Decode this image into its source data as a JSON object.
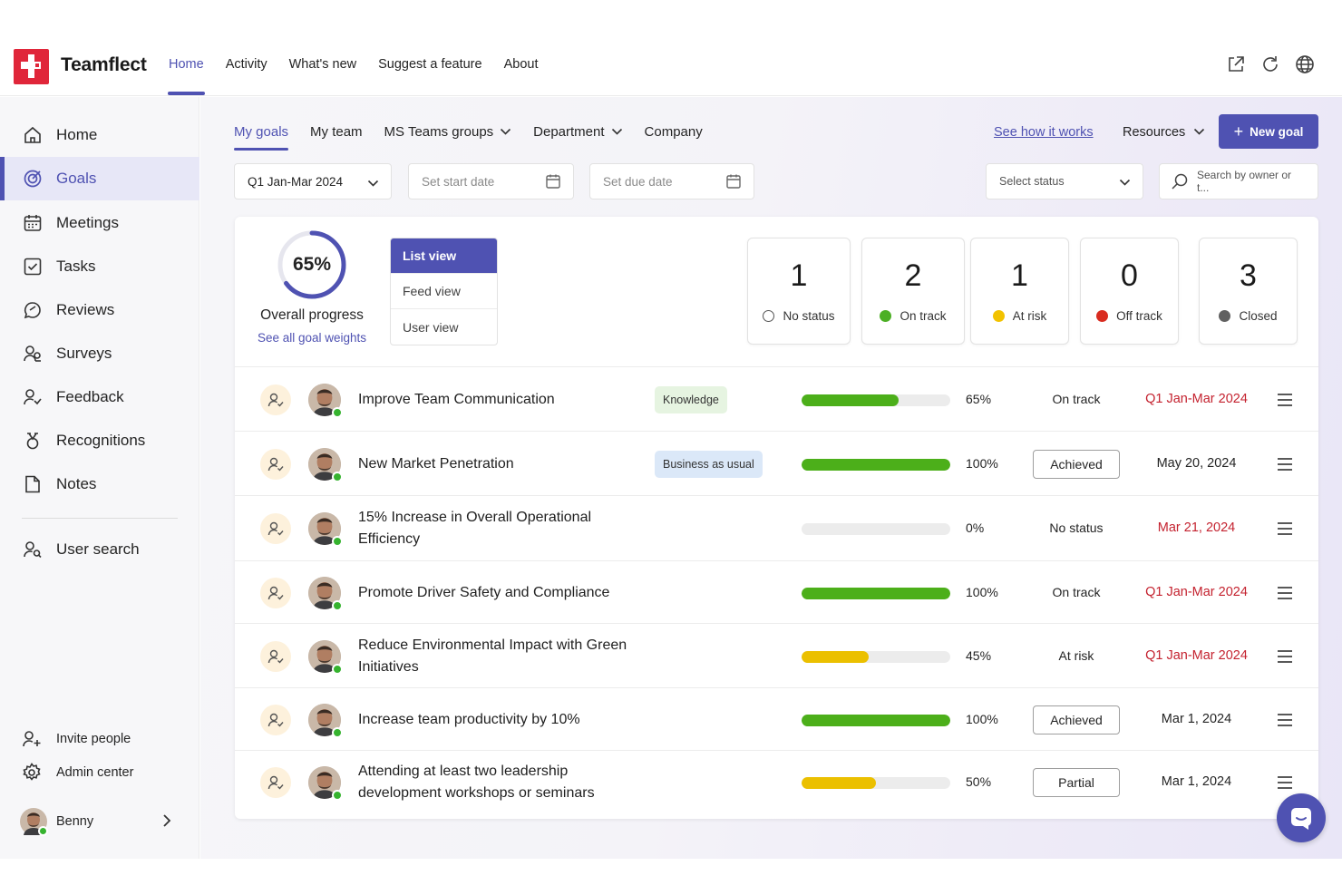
{
  "app": {
    "brand": "Teamflect"
  },
  "topnav": [
    {
      "label": "Home",
      "active": true
    },
    {
      "label": "Activity",
      "active": false
    },
    {
      "label": "What's new",
      "active": false
    },
    {
      "label": "Suggest a feature",
      "active": false
    },
    {
      "label": "About",
      "active": false
    }
  ],
  "top_icons": [
    "open-external-icon",
    "refresh-icon",
    "globe-icon"
  ],
  "sidebar": {
    "items": [
      {
        "label": "Home",
        "icon": "home-icon",
        "active": false
      },
      {
        "label": "Goals",
        "icon": "target-icon",
        "active": true
      },
      {
        "label": "Meetings",
        "icon": "calendar-icon",
        "active": false
      },
      {
        "label": "Tasks",
        "icon": "checkbox-icon",
        "active": false
      },
      {
        "label": "Reviews",
        "icon": "chat-bubble-icon",
        "active": false
      },
      {
        "label": "Surveys",
        "icon": "people-icon",
        "active": false
      },
      {
        "label": "Feedback",
        "icon": "person-feedback-icon",
        "active": false
      },
      {
        "label": "Recognitions",
        "icon": "ribbon-icon",
        "active": false
      },
      {
        "label": "Notes",
        "icon": "document-icon",
        "active": false
      }
    ],
    "user_search": "User search",
    "invite": "Invite people",
    "admin": "Admin center",
    "user_name": "Benny"
  },
  "goals_tabs": [
    {
      "label": "My goals",
      "active": true,
      "dropdown": false
    },
    {
      "label": "My team",
      "active": false,
      "dropdown": false
    },
    {
      "label": "MS Teams groups",
      "active": false,
      "dropdown": true
    },
    {
      "label": "Department",
      "active": false,
      "dropdown": true
    },
    {
      "label": "Company",
      "active": false,
      "dropdown": false
    }
  ],
  "header_actions": {
    "how_link": "See how it works",
    "resources": "Resources",
    "new_goal": "New goal"
  },
  "filters": {
    "period": "Q1 Jan-Mar 2024",
    "start_date_placeholder": "Set start date",
    "due_date_placeholder": "Set due date",
    "status_placeholder": "Select status",
    "search_placeholder": "Search by owner or t..."
  },
  "overview": {
    "progress_text": "65%",
    "progress_value": 0.65,
    "progress_label": "Overall progress",
    "weights_link": "See all goal weights",
    "views": [
      {
        "label": "List view",
        "active": true
      },
      {
        "label": "Feed view",
        "active": false
      },
      {
        "label": "User view",
        "active": false
      }
    ],
    "stats": [
      {
        "count": "1",
        "label": "No status",
        "color": "#ffffff"
      },
      {
        "count": "2",
        "label": "On track",
        "color": "#4caf25"
      },
      {
        "count": "1",
        "label": "At risk",
        "color": "#f2c200"
      },
      {
        "count": "0",
        "label": "Off track",
        "color": "#d92c20"
      },
      {
        "count": "3",
        "label": "Closed",
        "color": "#616161"
      }
    ]
  },
  "goals": [
    {
      "title": "Improve Team Communication",
      "tag": "Knowledge",
      "tag_color": "#e6f4e1",
      "progress_text": "65%",
      "progress": 0.65,
      "bar_color": "#4caf1a",
      "status": "On track",
      "status_boxed": false,
      "due": "Q1 Jan-Mar 2024",
      "due_red": true
    },
    {
      "title": "New Market Penetration",
      "tag": "Business as usual",
      "tag_color": "#dbe8f8",
      "progress_text": "100%",
      "progress": 1.0,
      "bar_color": "#4caf1a",
      "status": "Achieved",
      "status_boxed": true,
      "due": "May 20, 2024",
      "due_red": false
    },
    {
      "title": "15% Increase in Overall Operational Efficiency",
      "tag": "",
      "tag_color": "",
      "progress_text": "0%",
      "progress": 0.0,
      "bar_color": "#4caf1a",
      "status": "No status",
      "status_boxed": false,
      "due": "Mar 21, 2024",
      "due_red": true
    },
    {
      "title": "Promote Driver Safety and Compliance",
      "tag": "",
      "tag_color": "",
      "progress_text": "100%",
      "progress": 1.0,
      "bar_color": "#4caf1a",
      "status": "On track",
      "status_boxed": false,
      "due": "Q1 Jan-Mar 2024",
      "due_red": true
    },
    {
      "title": "Reduce Environmental Impact with Green Initiatives",
      "tag": "",
      "tag_color": "",
      "progress_text": "45%",
      "progress": 0.45,
      "bar_color": "#ebc000",
      "status": "At risk",
      "status_boxed": false,
      "due": "Q1 Jan-Mar 2024",
      "due_red": true
    },
    {
      "title": "Increase team productivity by 10%",
      "tag": "",
      "tag_color": "",
      "progress_text": "100%",
      "progress": 1.0,
      "bar_color": "#4caf1a",
      "status": "Achieved",
      "status_boxed": true,
      "due": "Mar 1, 2024",
      "due_red": false
    },
    {
      "title": "Attending at least two leadership development workshops or seminars",
      "tag": "",
      "tag_color": "",
      "progress_text": "50%",
      "progress": 0.5,
      "bar_color": "#ebc000",
      "status": "Partial",
      "status_boxed": true,
      "due": "Mar 1, 2024",
      "due_red": false
    }
  ],
  "colors": {
    "accent": "#4f52b2",
    "danger": "#c4222f"
  }
}
